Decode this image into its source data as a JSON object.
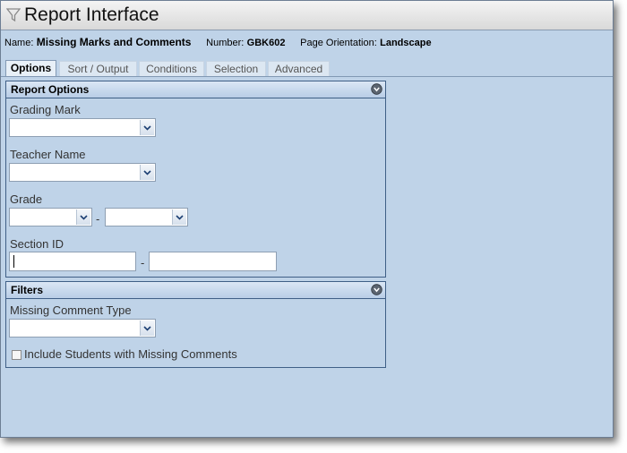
{
  "window": {
    "title": "Report Interface"
  },
  "info": {
    "name_label": "Name:",
    "name_value": "Missing Marks and Comments",
    "number_label": "Number:",
    "number_value": "GBK602",
    "orientation_label": "Page Orientation:",
    "orientation_value": "Landscape"
  },
  "tabs": [
    {
      "label": "Options",
      "active": true
    },
    {
      "label": "Sort / Output"
    },
    {
      "label": "Conditions"
    },
    {
      "label": "Selection"
    },
    {
      "label": "Advanced"
    }
  ],
  "report_options": {
    "header": "Report Options",
    "grading_mark": {
      "label": "Grading Mark",
      "value": ""
    },
    "teacher_name": {
      "label": "Teacher Name",
      "value": ""
    },
    "grade": {
      "label": "Grade",
      "from": "",
      "to": "",
      "separator": "-"
    },
    "section_id": {
      "label": "Section ID",
      "from": "",
      "to": "",
      "separator": "-"
    }
  },
  "filters": {
    "header": "Filters",
    "missing_comment_type": {
      "label": "Missing Comment Type",
      "value": ""
    },
    "include_students": {
      "label": "Include Students with Missing Comments",
      "checked": false
    }
  }
}
